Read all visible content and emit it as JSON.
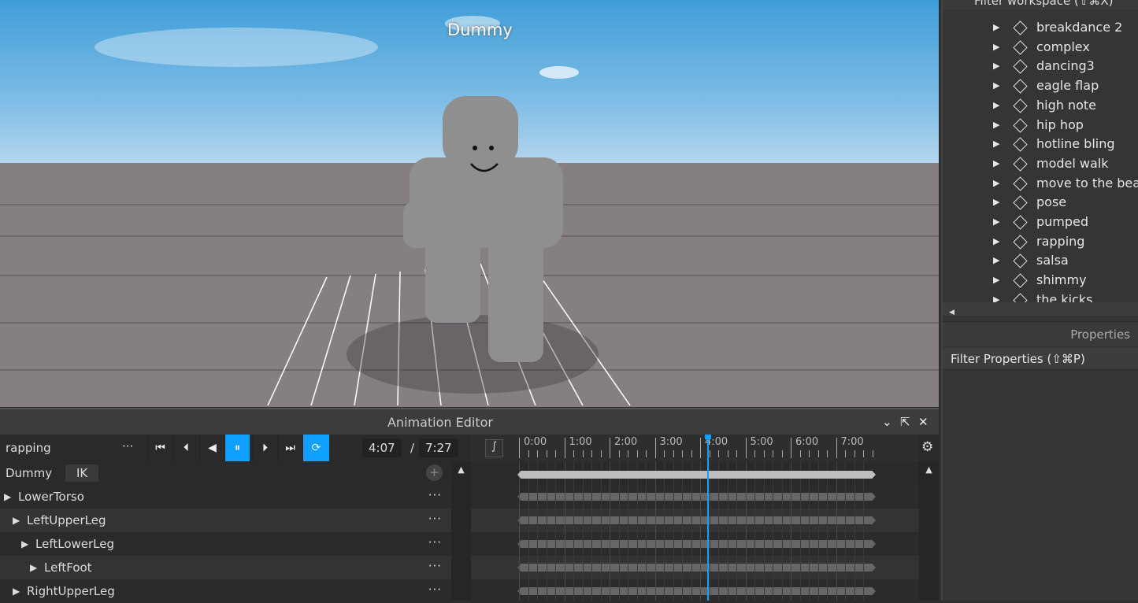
{
  "viewport": {
    "character_label": "Dummy"
  },
  "editor": {
    "title": "Animation Editor",
    "animation_name": "rapping",
    "current_time": "4:07",
    "separator": "/",
    "total_time": "7:27",
    "rig_name": "Dummy",
    "ik_label": "IK",
    "ticks": [
      "0:00",
      "1:00",
      "2:00",
      "3:00",
      "4:00",
      "5:00",
      "6:00",
      "7:00"
    ],
    "playhead_time": "4:07",
    "tracks": [
      {
        "label": "LowerTorso",
        "indent": 0
      },
      {
        "label": "LeftUpperLeg",
        "indent": 1
      },
      {
        "label": "LeftLowerLeg",
        "indent": 2
      },
      {
        "label": "LeftFoot",
        "indent": 3
      },
      {
        "label": "RightUpperLeg",
        "indent": 1
      }
    ],
    "accent": "#10a0ff"
  },
  "explorer": {
    "filter_label": "Filter workspace (⇧⌘X)",
    "items": [
      "breakdance 2",
      "complex",
      "dancing3",
      "eagle flap",
      "high note",
      "hip hop",
      "hotline bling",
      "model walk",
      "move to the beat",
      "pose",
      "pumped",
      "rapping",
      "salsa",
      "shimmy",
      "the kicks"
    ]
  },
  "properties": {
    "title": "Properties",
    "filter_label": "Filter Properties (⇧⌘P)"
  }
}
